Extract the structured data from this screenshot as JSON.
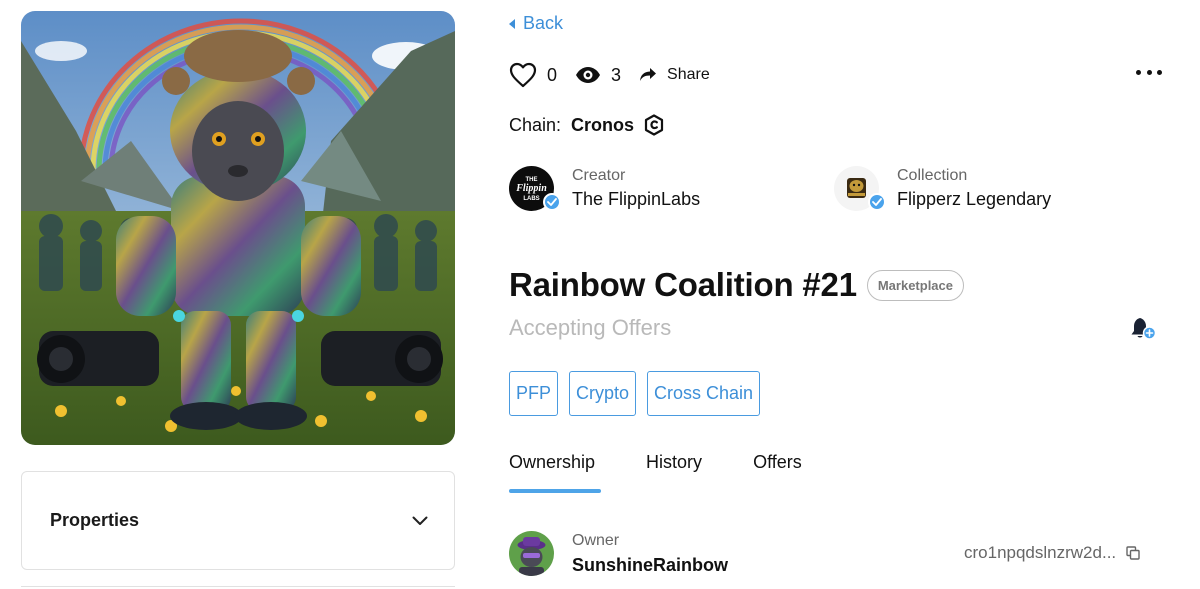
{
  "nav": {
    "back_label": "Back"
  },
  "stats": {
    "likes": "0",
    "views": "3",
    "share_label": "Share"
  },
  "chain": {
    "label": "Chain:",
    "name": "Cronos"
  },
  "creator": {
    "role": "Creator",
    "name": "The FlippinLabs",
    "avatar_text": "THE Flippin LABS"
  },
  "collection": {
    "role": "Collection",
    "name": "Flipperz Legendary"
  },
  "nft": {
    "title": "Rainbow Coalition #21",
    "badge": "Marketplace",
    "status": "Accepting Offers"
  },
  "tags": [
    "PFP",
    "Crypto",
    "Cross Chain"
  ],
  "tabs": [
    "Ownership",
    "History",
    "Offers"
  ],
  "active_tab": "Ownership",
  "owner": {
    "role": "Owner",
    "name": "SunshineRainbow",
    "address": "cro1npqdslnzrw2d..."
  },
  "properties": {
    "label": "Properties"
  },
  "colors": {
    "accent": "#3d8fd8",
    "verified": "#4aa3ec",
    "muted": "#b9b9b9"
  }
}
